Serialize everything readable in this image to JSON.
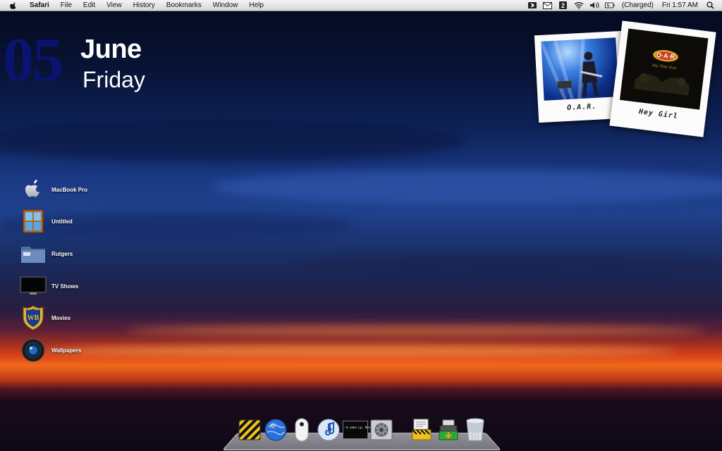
{
  "menubar": {
    "app_name": "Safari",
    "menus": [
      "File",
      "Edit",
      "View",
      "History",
      "Bookmarks",
      "Window",
      "Help"
    ],
    "battery_status": "(Charged)",
    "clock": "Fri 1:57 AM",
    "status_icons": [
      "bluetooth-icon",
      "mail-icon",
      "dashboard-icon",
      "wifi-icon",
      "volume-icon",
      "battery-icon",
      "spotlight-icon"
    ]
  },
  "date_widget": {
    "day": "05",
    "month": "June",
    "weekday": "Friday"
  },
  "now_playing": {
    "artist_caption": "O.A.R.",
    "song_caption": "Hey Girl",
    "album_logo": "O·A·R",
    "album_subtitle": "Any Time Now"
  },
  "desktop_items": [
    {
      "label": "MacBook Pro",
      "icon": "apple-drive-icon"
    },
    {
      "label": "Untitled",
      "icon": "window-folder-icon"
    },
    {
      "label": "Rutgers",
      "icon": "folder-icon"
    },
    {
      "label": "TV Shows",
      "icon": "tv-icon"
    },
    {
      "label": "Movies",
      "icon": "wb-shield-icon"
    },
    {
      "label": "Wallpapers",
      "icon": "camera-lens-icon"
    }
  ],
  "dock": {
    "items": [
      "finder-stripes-icon",
      "safari-globe-icon",
      "mouse-icon",
      "itunes-icon",
      "terminal-icon",
      "system-preferences-icon",
      "utilities-icon",
      "downloads-icon",
      "trash-icon"
    ],
    "terminal_text": "~$ wake up, Neo"
  },
  "colors": {
    "day_number": "#0a1470",
    "menubar_bg": "#e6e6e6",
    "sunset_orange": "#f2691a"
  }
}
